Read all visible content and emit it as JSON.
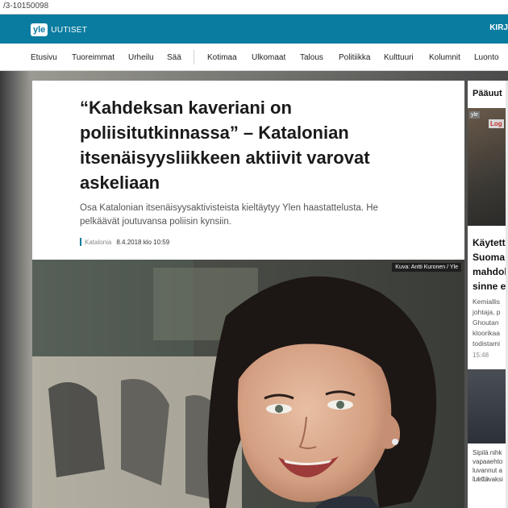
{
  "browser": {
    "url_fragment": "/3-10150098"
  },
  "header": {
    "logo_badge": "yle",
    "logo_text": "UUTISET",
    "right_link": "KIRJ"
  },
  "nav": {
    "items": [
      "Etusivu",
      "Tuoreimmat",
      "Urheilu",
      "Sää",
      "Kotimaa",
      "Ulkomaat",
      "Talous",
      "Politiikka",
      "Kulttuuri",
      "Kolumnit",
      "Luonto"
    ]
  },
  "article": {
    "headline": "“Kahdeksan kaveriani on poliisitutkinnassa” – Katalonian itsenäisyysliikkeen aktiivit varovat askeliaan",
    "lead": "Osa Katalonian itsenäisyysaktivisteista kieltäytyy Ylen haastattelusta. He pelkäävät joutuvansa poliisin kynsiin.",
    "category": "Katalonia",
    "date": "8.4.2018 klo 10:59",
    "photo_credit": "Kuva: Antti Kuronen / Yle"
  },
  "sidebar": {
    "title": "Pääuut",
    "img_tag": "yle",
    "img_tag2": "Log",
    "story1_headline": "Käytett Suoma mahdol sinne e",
    "story1_body": "Kemiallis johtaja, p Ghoutan kloorikaa todistami",
    "story1_time": "15:48",
    "story2_body": "Sipilä nihk vapaaehto luvannut a luettavaksi",
    "story2_time": "14:20"
  },
  "colors": {
    "brand": "#0a7ca0"
  }
}
